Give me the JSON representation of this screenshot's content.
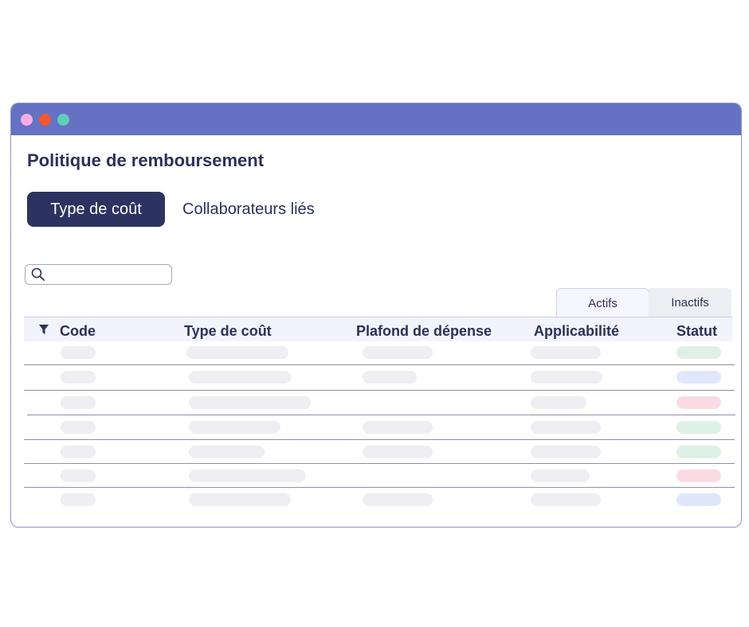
{
  "window": {
    "titlebar_color": "#6571c3",
    "traffic_lights": [
      {
        "name": "pink-dot",
        "color": "#f6aee9"
      },
      {
        "name": "orange-dot",
        "color": "#f3572f"
      },
      {
        "name": "teal-dot",
        "color": "#5dcfb8"
      }
    ]
  },
  "page": {
    "title": "Politique de remboursement"
  },
  "main_tabs": [
    {
      "label": "Type de coût",
      "active": true
    },
    {
      "label": "Collaborateurs liés",
      "active": false
    }
  ],
  "search": {
    "placeholder": "",
    "icon": "search-icon"
  },
  "sub_tabs": [
    {
      "label": "Actifs",
      "active": true
    },
    {
      "label": "Inactifs",
      "active": false
    }
  ],
  "table": {
    "filter_icon": "filter-icon",
    "columns": [
      "Code",
      "Type de coût",
      "Plafond de dépense",
      "Applicabilité",
      "Statut"
    ],
    "rows": [
      {
        "statut": "green"
      },
      {
        "statut": "blue"
      },
      {
        "statut": "pink"
      },
      {
        "statut": "green"
      },
      {
        "statut": "green"
      },
      {
        "statut": "pink"
      },
      {
        "statut": "blue"
      }
    ],
    "status_colors": {
      "green": "#dff0e7",
      "blue": "#e1e7fb",
      "pink": "#fadbe4"
    }
  }
}
